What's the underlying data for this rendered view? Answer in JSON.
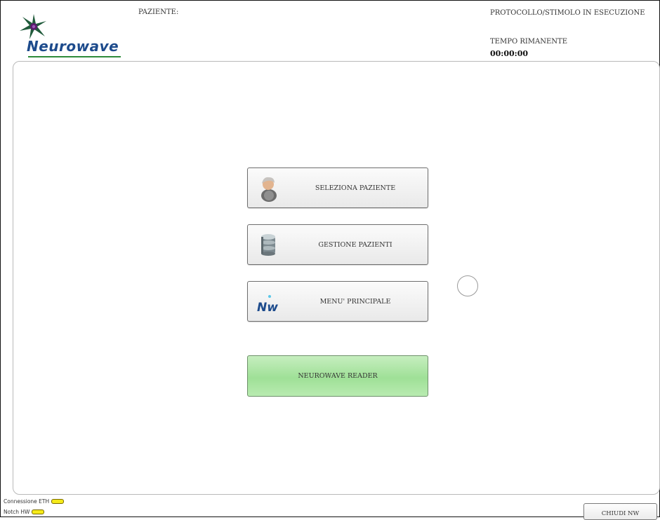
{
  "header": {
    "brand": "Neurowave",
    "patient_label": "PAZIENTE:",
    "protocol_label": "PROTOCOLLO/STIMOLO IN ESECUZIONE",
    "time_label": "TEMPO RIMANENTE",
    "time_value": "00:00:00"
  },
  "menu": {
    "select_patient": {
      "label": "SELEZIONA PAZIENTE",
      "icon": "person-icon"
    },
    "manage_patients": {
      "label": "GESTIONE PAZIENTI",
      "icon": "database-icon"
    },
    "main_menu": {
      "label": "MENU' PRINCIPALE",
      "icon": "nw-logo-icon",
      "icon_text": "Nw"
    },
    "reader": {
      "label": "NEUROWAVE READER"
    }
  },
  "status": {
    "eth_label": "Connessione ETH",
    "notch_label": "Notch HW",
    "led_color": "#f5ea19"
  },
  "footer": {
    "close_label": "CHIUDI NW"
  },
  "colors": {
    "brand_blue": "#1d4b8c",
    "brand_green": "#2e8b3a",
    "reader_green": "#9fe097"
  }
}
